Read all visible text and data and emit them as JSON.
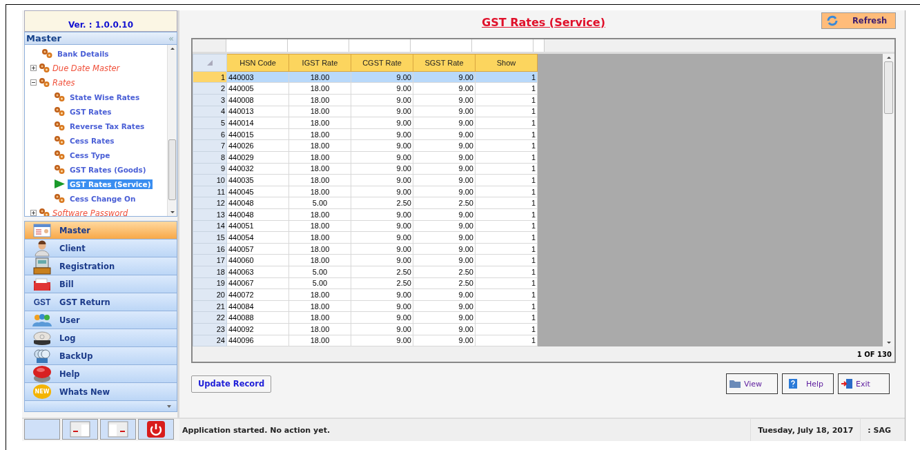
{
  "sidebar": {
    "version": "Ver. : 1.0.0.10",
    "panel_title": "Master",
    "collapse_glyph": "«",
    "tree": [
      {
        "children": [
          {
            "label": "Bank Details",
            "selected": false
          }
        ]
      },
      {
        "label": "Due Date Master",
        "kind": "folder",
        "expanded": false
      },
      {
        "label": "Rates",
        "kind": "folder",
        "expanded": true,
        "children": [
          {
            "label": "State Wise Rates",
            "selected": false
          },
          {
            "label": "GST Rates",
            "selected": false
          },
          {
            "label": "Reverse Tax Rates",
            "selected": false
          },
          {
            "label": "Cess Rates",
            "selected": false
          },
          {
            "label": "Cess Type",
            "selected": false
          },
          {
            "label": "GST Rates (Goods)",
            "selected": false
          },
          {
            "label": "GST Rates (Service)",
            "selected": true
          },
          {
            "label": "Cess Change On",
            "selected": false
          }
        ]
      },
      {
        "label": "Software Password",
        "kind": "folder",
        "expanded": false
      }
    ],
    "nav": [
      {
        "label": "Master",
        "selected": true
      },
      {
        "label": "Client",
        "selected": false
      },
      {
        "label": "Registration",
        "selected": false
      },
      {
        "label": "Bill",
        "selected": false
      },
      {
        "label": "GST Return",
        "selected": false,
        "badge": "GST"
      },
      {
        "label": "User",
        "selected": false
      },
      {
        "label": "Log",
        "selected": false
      },
      {
        "label": "BackUp",
        "selected": false
      },
      {
        "label": "Help",
        "selected": false
      },
      {
        "label": "Whats New",
        "selected": false,
        "badge": "NEW"
      }
    ]
  },
  "main": {
    "title": "GST Rates (Service)",
    "refresh_button": "Refresh",
    "table": {
      "columns": [
        "HSN Code",
        "IGST Rate",
        "CGST Rate",
        "SGST Rate",
        "Show"
      ],
      "rows": [
        {
          "num": "1",
          "cells": [
            "440003",
            "18.00",
            "9.00",
            "9.00",
            "1"
          ],
          "selected": true
        },
        {
          "num": "2",
          "cells": [
            "440005",
            "18.00",
            "9.00",
            "9.00",
            "1"
          ],
          "selected": false
        },
        {
          "num": "3",
          "cells": [
            "440008",
            "18.00",
            "9.00",
            "9.00",
            "1"
          ],
          "selected": false
        },
        {
          "num": "4",
          "cells": [
            "440013",
            "18.00",
            "9.00",
            "9.00",
            "1"
          ],
          "selected": false
        },
        {
          "num": "5",
          "cells": [
            "440014",
            "18.00",
            "9.00",
            "9.00",
            "1"
          ],
          "selected": false
        },
        {
          "num": "6",
          "cells": [
            "440015",
            "18.00",
            "9.00",
            "9.00",
            "1"
          ],
          "selected": false
        },
        {
          "num": "7",
          "cells": [
            "440026",
            "18.00",
            "9.00",
            "9.00",
            "1"
          ],
          "selected": false
        },
        {
          "num": "8",
          "cells": [
            "440029",
            "18.00",
            "9.00",
            "9.00",
            "1"
          ],
          "selected": false
        },
        {
          "num": "9",
          "cells": [
            "440032",
            "18.00",
            "9.00",
            "9.00",
            "1"
          ],
          "selected": false
        },
        {
          "num": "10",
          "cells": [
            "440035",
            "18.00",
            "9.00",
            "9.00",
            "1"
          ],
          "selected": false
        },
        {
          "num": "11",
          "cells": [
            "440045",
            "18.00",
            "9.00",
            "9.00",
            "1"
          ],
          "selected": false
        },
        {
          "num": "12",
          "cells": [
            "440048",
            "5.00",
            "2.50",
            "2.50",
            "1"
          ],
          "selected": false
        },
        {
          "num": "13",
          "cells": [
            "440048",
            "18.00",
            "9.00",
            "9.00",
            "1"
          ],
          "selected": false
        },
        {
          "num": "14",
          "cells": [
            "440051",
            "18.00",
            "9.00",
            "9.00",
            "1"
          ],
          "selected": false
        },
        {
          "num": "15",
          "cells": [
            "440054",
            "18.00",
            "9.00",
            "9.00",
            "1"
          ],
          "selected": false
        },
        {
          "num": "16",
          "cells": [
            "440057",
            "18.00",
            "9.00",
            "9.00",
            "1"
          ],
          "selected": false
        },
        {
          "num": "17",
          "cells": [
            "440060",
            "18.00",
            "9.00",
            "9.00",
            "1"
          ],
          "selected": false
        },
        {
          "num": "18",
          "cells": [
            "440063",
            "5.00",
            "2.50",
            "2.50",
            "1"
          ],
          "selected": false
        },
        {
          "num": "19",
          "cells": [
            "440067",
            "5.00",
            "2.50",
            "2.50",
            "1"
          ],
          "selected": false
        },
        {
          "num": "20",
          "cells": [
            "440072",
            "18.00",
            "9.00",
            "9.00",
            "1"
          ],
          "selected": false
        },
        {
          "num": "21",
          "cells": [
            "440084",
            "18.00",
            "9.00",
            "9.00",
            "1"
          ],
          "selected": false
        },
        {
          "num": "22",
          "cells": [
            "440088",
            "18.00",
            "9.00",
            "9.00",
            "1"
          ],
          "selected": false
        },
        {
          "num": "23",
          "cells": [
            "440092",
            "18.00",
            "9.00",
            "9.00",
            "1"
          ],
          "selected": false
        },
        {
          "num": "24",
          "cells": [
            "440096",
            "18.00",
            "9.00",
            "9.00",
            "1"
          ],
          "selected": false
        }
      ],
      "record_count": "1 OF 130"
    },
    "update_button": "Update Record",
    "buttons": [
      {
        "label": "View",
        "kind": "view"
      },
      {
        "label": "Help",
        "kind": "help"
      },
      {
        "label": "Exit",
        "kind": "exit"
      }
    ]
  },
  "status_bar": {
    "message": "Application started. No action yet.",
    "date": "Tuesday, July 18, 2017",
    "user": ": SAG"
  }
}
